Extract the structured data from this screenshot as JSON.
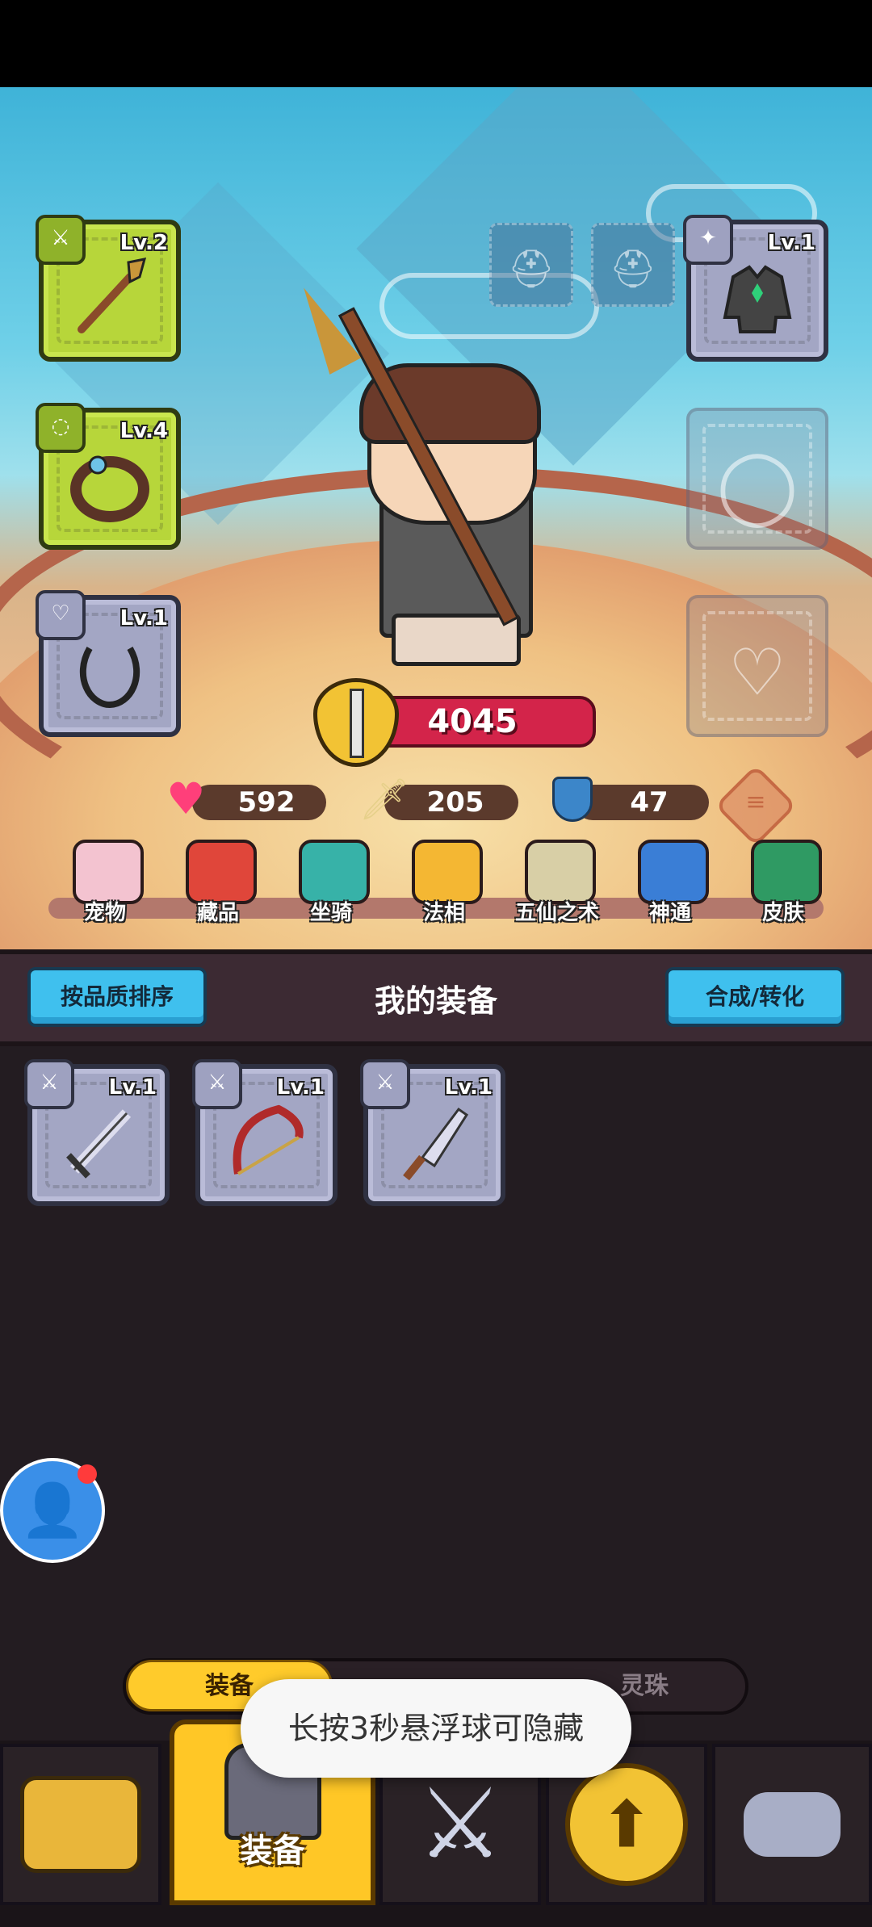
{
  "hero": {
    "power": "4045",
    "stats": {
      "hp": "592",
      "attack": "205",
      "defense": "47"
    }
  },
  "slots": {
    "weapon": {
      "level": "Lv.2",
      "quality": "green",
      "icon": "spear-icon"
    },
    "ring": {
      "level": "Lv.4",
      "quality": "green",
      "icon": "ring-icon"
    },
    "necklace": {
      "level": "Lv.1",
      "quality": "grey",
      "icon": "necklace-icon"
    },
    "armor": {
      "level": "Lv.1",
      "quality": "grey",
      "icon": "armor-icon"
    },
    "ring_empty": {
      "icon": "ring-placeholder-icon"
    },
    "necklace_empty": {
      "icon": "necklace-placeholder-icon"
    },
    "helmet_a": {
      "icon": "helmet-placeholder-icon"
    },
    "helmet_b": {
      "icon": "helmet-placeholder-icon"
    }
  },
  "features": [
    {
      "label": "宠物",
      "color": "#f3c3d0"
    },
    {
      "label": "藏品",
      "color": "#e0463a"
    },
    {
      "label": "坐骑",
      "color": "#37b2a8"
    },
    {
      "label": "法相",
      "color": "#f4b733"
    },
    {
      "label": "五仙之术",
      "color": "#d8cfa6"
    },
    {
      "label": "神通",
      "color": "#3a7ed6"
    },
    {
      "label": "皮肤",
      "color": "#2f9a63"
    }
  ],
  "inventory": {
    "sort_button": "按品质排序",
    "title": "我的装备",
    "craft_button": "合成/转化",
    "items": [
      {
        "level": "Lv.1",
        "icon": "sword-icon"
      },
      {
        "level": "Lv.1",
        "icon": "bow-icon"
      },
      {
        "level": "Lv.1",
        "icon": "blade-icon"
      }
    ]
  },
  "subtabs": {
    "active": "装备",
    "middle": "",
    "right": "灵珠"
  },
  "toast": "长按3秒悬浮球可隐藏",
  "nav": {
    "active_label": "装备"
  }
}
